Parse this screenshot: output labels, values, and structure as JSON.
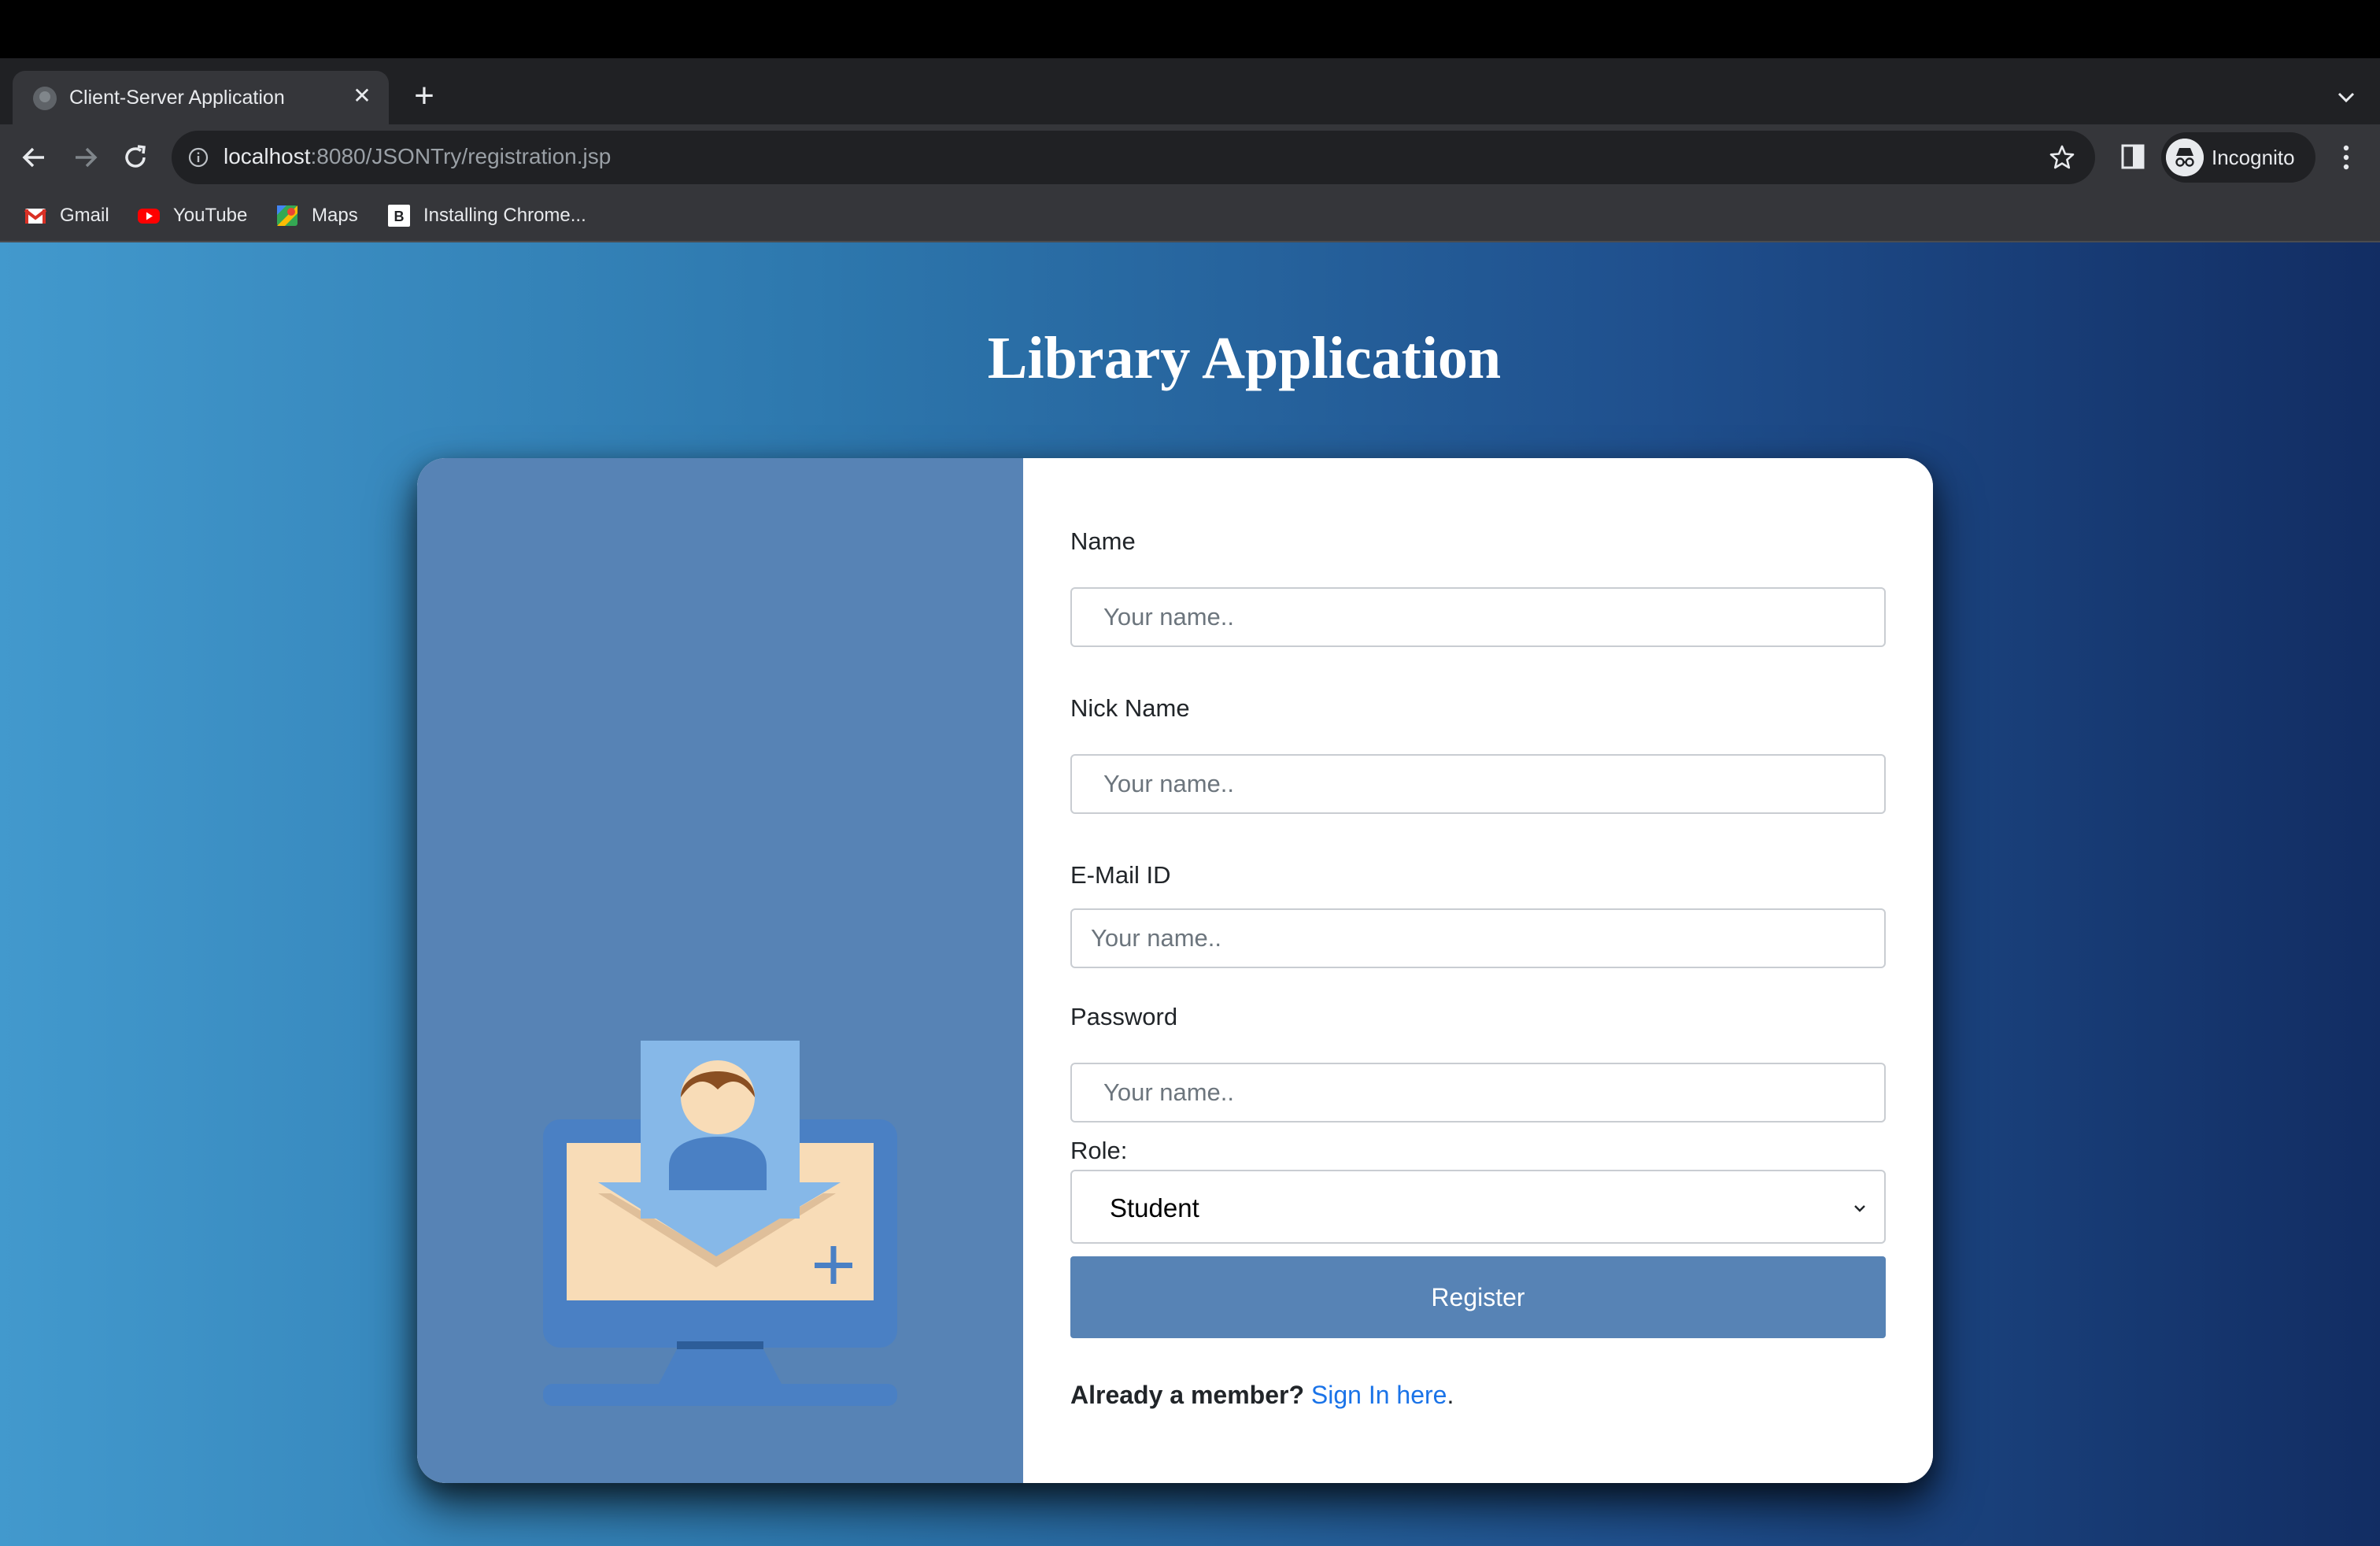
{
  "browser": {
    "tab_title": "Client-Server Application",
    "url_host": "localhost",
    "url_path": ":8080/JSONTry/registration.jsp",
    "profile_label": "Incognito",
    "bookmarks": [
      {
        "label": "Gmail",
        "icon": "gmail-icon"
      },
      {
        "label": "YouTube",
        "icon": "youtube-icon"
      },
      {
        "label": "Maps",
        "icon": "maps-icon"
      },
      {
        "label": "Installing Chrome...",
        "icon": "bookmark-b-icon"
      }
    ]
  },
  "page": {
    "title": "Library Application",
    "background_colors": [
      "#4299cd",
      "#122d63"
    ],
    "form": {
      "fields": [
        {
          "label": "Name",
          "placeholder": "Your name.."
        },
        {
          "label": "Nick Name",
          "placeholder": "Your name.."
        },
        {
          "label": "E-Mail ID",
          "placeholder": "Your name.."
        },
        {
          "label": "Password",
          "placeholder": "Your name.."
        }
      ],
      "role_label": "Role:",
      "role_value": "Student",
      "register_label": "Register",
      "member_text": "Already a member?",
      "signin_link": "Sign In here",
      "signin_suffix": ".",
      "accent_color": "#5783b5",
      "link_color": "#1a73e8"
    }
  }
}
